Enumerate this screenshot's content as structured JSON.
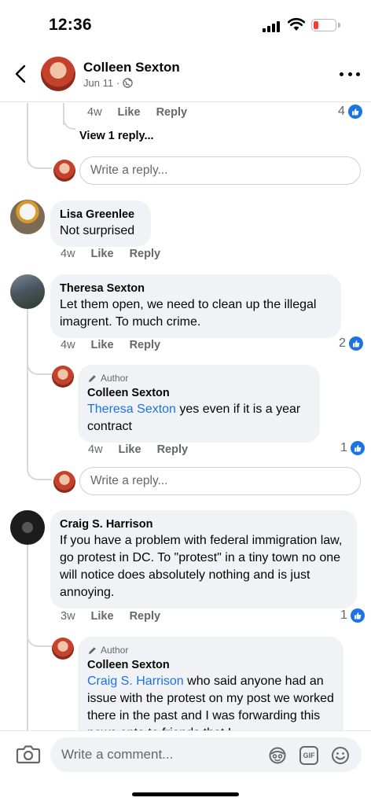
{
  "status_bar": {
    "time": "12:36",
    "battery_color": "#ff3b30"
  },
  "header": {
    "name": "Colleen Sexton",
    "date": "Jun 11",
    "separator": "·",
    "privacy_icon": "globe-icon",
    "back_icon": "chevron-left-icon",
    "more_icon": "more-horizontal-icon"
  },
  "thread_top": {
    "age": "4w",
    "like": "Like",
    "reply": "Reply",
    "reaction_count": "4",
    "view_replies": "View 1 reply...",
    "reply_placeholder": "Write a reply..."
  },
  "comments": [
    {
      "name": "Lisa Greenlee",
      "text": "Not surprised",
      "age": "4w",
      "like": "Like",
      "reply": "Reply"
    },
    {
      "name": "Theresa Sexton",
      "text": "Let them open, we need to clean up the illegal imagrent.  To much crime.",
      "age": "4w",
      "like": "Like",
      "reply": "Reply",
      "reaction_count": "2",
      "replies": [
        {
          "badge": "Author",
          "name": "Colleen Sexton",
          "mention": "Theresa Sexton",
          "text": " yes even if it is a year contract",
          "age": "4w",
          "like": "Like",
          "reply": "Reply",
          "reaction_count": "1"
        }
      ],
      "reply_placeholder": "Write a reply..."
    },
    {
      "name": "Craig S. Harrison",
      "text": "If you have a problem with federal immigration law, go protest in DC. To \"protest\" in a tiny town no one will notice does absolutely nothing and is just annoying.",
      "age": "3w",
      "like": "Like",
      "reply": "Reply",
      "reaction_count": "1",
      "replies": [
        {
          "badge": "Author",
          "name": "Colleen Sexton",
          "mention": "Craig S. Harrison",
          "text": " who said anyone had an issue with the protest on my post we worked there in the past and I was forwarding this news onto to friends that I"
        }
      ]
    }
  ],
  "composer": {
    "placeholder": "Write a comment...",
    "gif_label": "GIF",
    "icons": [
      "camera-icon",
      "avatar-sticker-icon",
      "gif-icon",
      "emoji-icon"
    ]
  },
  "colors": {
    "accent": "#1b74e4",
    "bubble": "#f0f2f5",
    "muted": "#65676b"
  }
}
